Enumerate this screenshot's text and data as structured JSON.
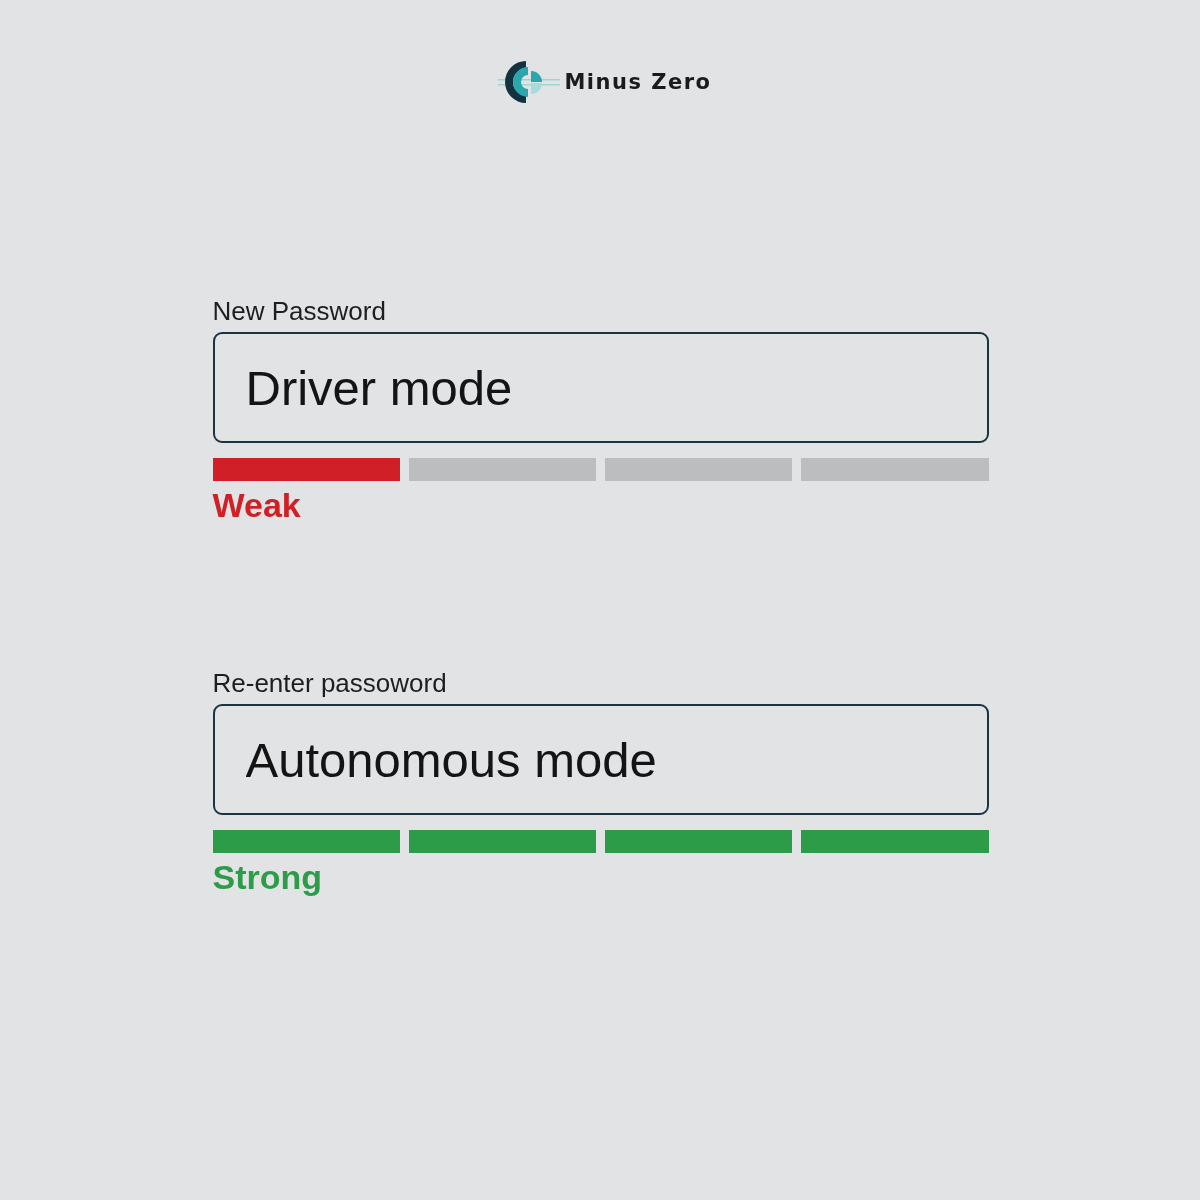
{
  "brand": {
    "name": "Minus Zero"
  },
  "fields": [
    {
      "label": "New Password",
      "value": "Driver mode",
      "segments": [
        {
          "filled": true
        },
        {
          "filled": false
        },
        {
          "filled": false
        },
        {
          "filled": false
        }
      ],
      "strength": {
        "text": "Weak",
        "color": "#d01f27"
      }
    },
    {
      "label": "Re-enter passoword",
      "value": "Autonomous mode",
      "segments": [
        {
          "filled": true
        },
        {
          "filled": true
        },
        {
          "filled": true
        },
        {
          "filled": true
        }
      ],
      "strength": {
        "text": "Strong",
        "color": "#2d9c48"
      }
    }
  ]
}
